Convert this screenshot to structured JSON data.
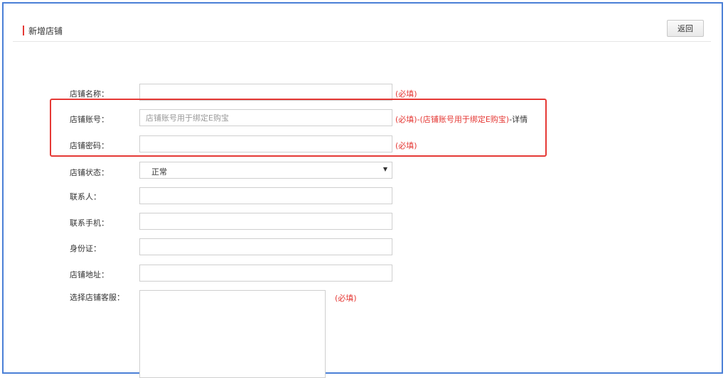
{
  "header": {
    "title": "新增店铺",
    "back_label": "返回"
  },
  "form": {
    "store_name": {
      "label": "店铺名称：",
      "value": "",
      "required": "(必填)"
    },
    "store_account": {
      "label": "店铺账号：",
      "value": "",
      "placeholder": "店铺账号用于绑定E购宝",
      "required": "(必填)-(店铺账号用于绑定E购宝)",
      "detail_sep": "-",
      "detail": "详情"
    },
    "store_password": {
      "label": "店铺密码：",
      "value": "",
      "required": "(必填)"
    },
    "store_status": {
      "label": "店铺状态：",
      "selected": "正常"
    },
    "contact": {
      "label": "联系人：",
      "value": ""
    },
    "contact_phone": {
      "label": "联系手机：",
      "value": ""
    },
    "id_card": {
      "label": "身份证：",
      "value": ""
    },
    "store_address": {
      "label": "店铺地址：",
      "value": ""
    },
    "customer_service": {
      "label": "选择店铺客服：",
      "required": "(必填)"
    }
  },
  "colors": {
    "accent_red": "#e53935",
    "frame_blue": "#4a7fd6"
  },
  "icons": {
    "select_arrow": "caret-down-icon"
  }
}
